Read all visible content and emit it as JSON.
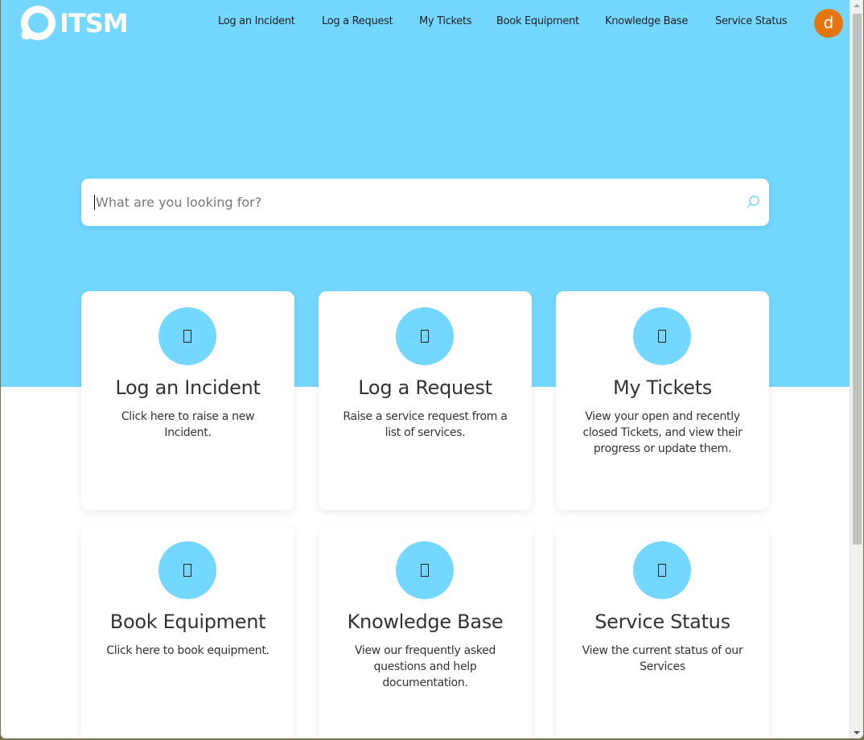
{
  "brand": {
    "logo_text": "ITSM",
    "accent": "#73d7ff",
    "avatar_color": "#e5750e"
  },
  "nav": {
    "items": [
      {
        "label": "Log an Incident"
      },
      {
        "label": "Log a Request"
      },
      {
        "label": "My Tickets"
      },
      {
        "label": "Book Equipment"
      },
      {
        "label": "Knowledge Base"
      },
      {
        "label": "Service Status"
      }
    ],
    "avatar_initial": "d"
  },
  "search": {
    "placeholder": "What are you looking for?",
    "value": ""
  },
  "cards": [
    {
      "title": "Log an Incident",
      "description": "Click here to raise a new Incident.",
      "icon": "incident-icon"
    },
    {
      "title": "Log a Request",
      "description": "Raise a service request from a list of services.",
      "icon": "request-icon"
    },
    {
      "title": "My Tickets",
      "description": "View your open and recently closed Tickets, and view their progress or update them.",
      "icon": "tickets-icon"
    },
    {
      "title": "Book Equipment",
      "description": "Click here to book equipment.",
      "icon": "equipment-icon"
    },
    {
      "title": "Knowledge Base",
      "description": "View our frequently asked questions and help documentation.",
      "icon": "knowledge-icon"
    },
    {
      "title": "Service Status",
      "description": "View the current status of our Services",
      "icon": "status-icon"
    }
  ]
}
